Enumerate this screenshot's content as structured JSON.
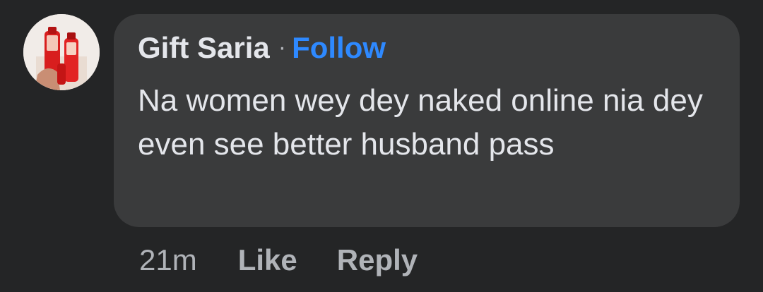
{
  "comment": {
    "author": "Gift Saria",
    "separator": "·",
    "follow_label": "Follow",
    "text": "Na women wey dey naked online nia dey even see better husband pass",
    "timestamp": "21m",
    "like_label": "Like",
    "reply_label": "Reply",
    "avatar_icon": "profile-avatar"
  },
  "colors": {
    "background": "#242526",
    "bubble": "#3a3b3c",
    "primary_text": "#e4e6eb",
    "secondary_text": "#b0b3b8",
    "follow_link": "#2e89ff"
  }
}
